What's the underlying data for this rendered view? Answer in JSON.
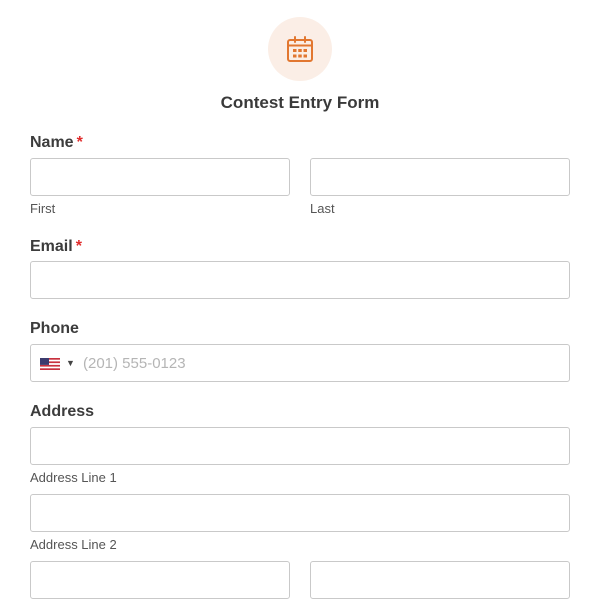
{
  "form": {
    "title": "Contest Entry Form",
    "accent_color": "#e27730",
    "icon": "calendar-icon",
    "required_marker": "*",
    "name": {
      "label": "Name",
      "first_sublabel": "First",
      "last_sublabel": "Last",
      "first_value": "",
      "last_value": ""
    },
    "email": {
      "label": "Email",
      "value": ""
    },
    "phone": {
      "label": "Phone",
      "country": "US",
      "flag_icon": "us-flag-icon",
      "placeholder": "(201) 555-0123",
      "value": ""
    },
    "address": {
      "label": "Address",
      "line1_sublabel": "Address Line 1",
      "line2_sublabel": "Address Line 2",
      "line1_value": "",
      "line2_value": "",
      "city_value": "",
      "state_value": ""
    }
  }
}
